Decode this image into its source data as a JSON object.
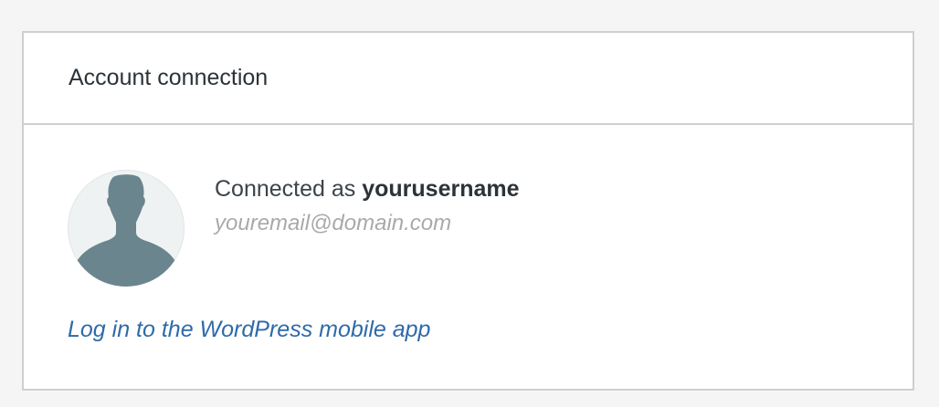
{
  "card": {
    "title": "Account connection"
  },
  "account": {
    "connected_prefix": "Connected as",
    "username": "yourusername",
    "email": "youremail@domain.com",
    "avatar_icon": "default-user-silhouette-icon"
  },
  "links": {
    "mobile_app": "Log in to the WordPress mobile app"
  },
  "colors": {
    "link": "#2f6aa9",
    "avatar_background": "#eff2f2",
    "avatar_silhouette": "#6b858f",
    "muted_text": "#a7aaad",
    "border": "#cfcfd1"
  }
}
